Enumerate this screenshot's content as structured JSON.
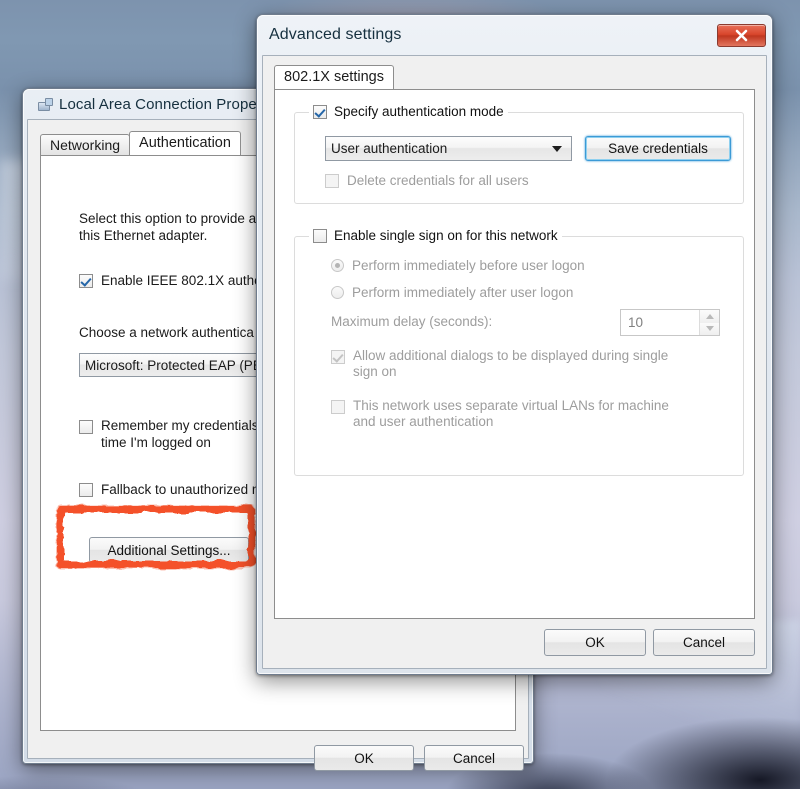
{
  "background": {
    "name": "desktop-wallpaper",
    "colors": {
      "sky": "#7d93ae",
      "ice": "#c8cbdd",
      "dark": "#0a0c18"
    }
  },
  "properties_window": {
    "title": "Local Area Connection Prope",
    "icon": "network-adapter-icon",
    "tabs": [
      {
        "label": "Networking",
        "active": false
      },
      {
        "label": "Authentication",
        "active": true
      }
    ],
    "intro_line1": "Select this option to provide a",
    "intro_line2": "this Ethernet adapter.",
    "enable_8021x": {
      "label": "Enable IEEE 802.1X authe",
      "checked": true
    },
    "choose_method_label": "Choose a network authentica",
    "method_combo": {
      "value": "Microsoft: Protected EAP (PE"
    },
    "remember_credentials": {
      "line1": "Remember my credentials",
      "line2": "time I'm logged on",
      "checked": false
    },
    "fallback": {
      "label": "Fallback to unauthorized n",
      "checked": false
    },
    "additional_settings_button": "Additional Settings...",
    "ok_button": "OK",
    "cancel_button": "Cancel"
  },
  "advanced_window": {
    "title": "Advanced settings",
    "close_label": "x",
    "tabs": [
      {
        "label": "802.1X settings",
        "active": true
      }
    ],
    "auth_mode_group": {
      "title": "Specify authentication mode",
      "checked": true,
      "combo_value": "User authentication",
      "save_credentials_button": "Save credentials",
      "delete_credentials": {
        "label": "Delete credentials for all users",
        "checked": false,
        "disabled": true
      }
    },
    "sso_group": {
      "title": "Enable single sign on for this network",
      "checked": false,
      "radio_before": {
        "label": "Perform immediately before user logon",
        "selected": true,
        "disabled": true
      },
      "radio_after": {
        "label": "Perform immediately after user logon",
        "selected": false,
        "disabled": true
      },
      "max_delay_label": "Maximum delay (seconds):",
      "max_delay_value": "10",
      "allow_dialogs": {
        "line1": "Allow additional dialogs to be displayed during single",
        "line2": "sign on",
        "checked": true,
        "disabled": true
      },
      "separate_vlans": {
        "line1": "This network uses separate virtual LANs for machine",
        "line2": "and user authentication",
        "checked": false,
        "disabled": true
      }
    },
    "ok_button": "OK",
    "cancel_button": "Cancel"
  },
  "annotation": {
    "name": "highlight-rectangle",
    "color": "#f4512c",
    "target": "Additional Settings..."
  }
}
